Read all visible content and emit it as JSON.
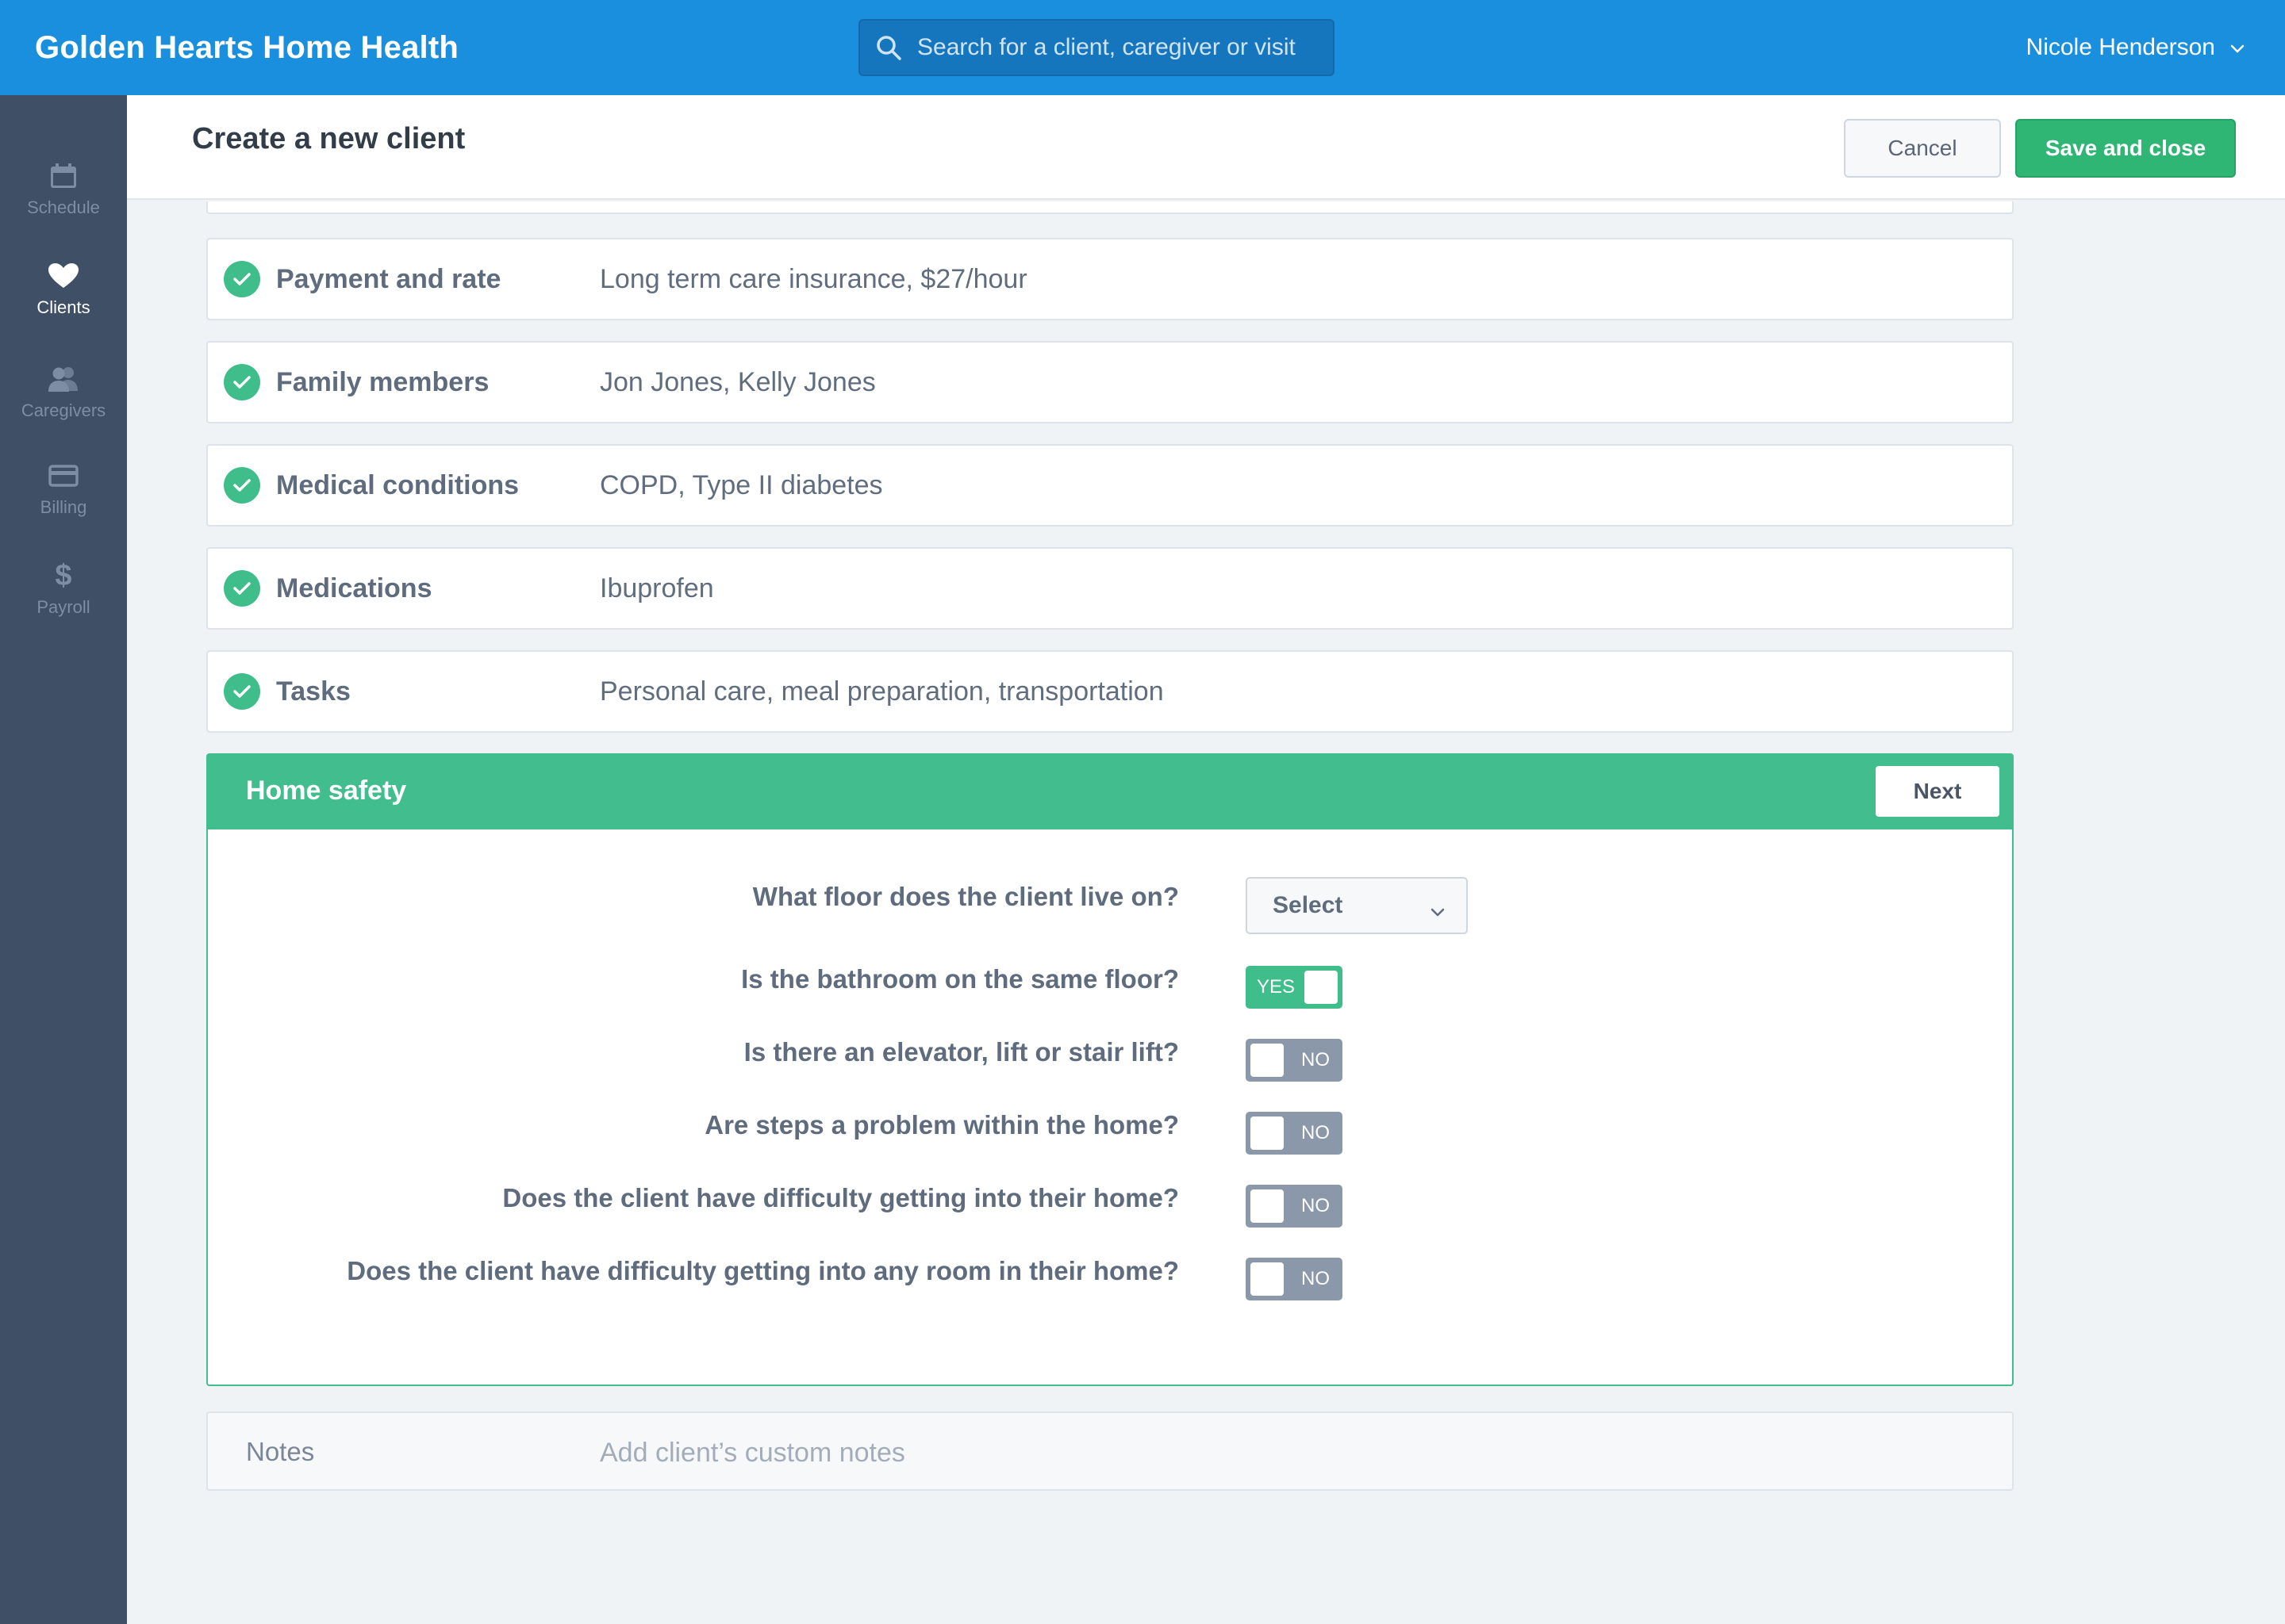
{
  "app": {
    "title": "Golden Hearts Home Health"
  },
  "search": {
    "placeholder": "Search for a client, caregiver or visit"
  },
  "user": {
    "name": "Nicole Henderson"
  },
  "sidebar": {
    "items": [
      {
        "label": "Schedule",
        "icon": "calendar-icon",
        "active": false
      },
      {
        "label": "Clients",
        "icon": "heart-icon",
        "active": true
      },
      {
        "label": "Caregivers",
        "icon": "people-icon",
        "active": false
      },
      {
        "label": "Billing",
        "icon": "credit-card-icon",
        "active": false
      },
      {
        "label": "Payroll",
        "icon": "dollar-icon",
        "active": false
      }
    ]
  },
  "page": {
    "title": "Create a new client",
    "cancel_label": "Cancel",
    "save_label": "Save and close"
  },
  "sections": [
    {
      "label": "Payment and rate",
      "value": "Long term care insurance, $27/hour",
      "complete": true
    },
    {
      "label": "Family members",
      "value": "Jon Jones, Kelly Jones",
      "complete": true
    },
    {
      "label": "Medical conditions",
      "value": "COPD, Type II diabetes",
      "complete": true
    },
    {
      "label": "Medications",
      "value": "Ibuprofen",
      "complete": true
    },
    {
      "label": "Tasks",
      "value": "Personal care, meal preparation, transportation",
      "complete": true
    }
  ],
  "home_safety": {
    "title": "Home safety",
    "next_label": "Next",
    "floor_question": "What floor does the client live on?",
    "floor_select": "Select",
    "questions": [
      {
        "text": "Is the bathroom on the same floor?",
        "value": "YES",
        "on": true
      },
      {
        "text": "Is there an elevator, lift or stair lift?",
        "value": "NO",
        "on": false
      },
      {
        "text": "Are steps a problem within the home?",
        "value": "NO",
        "on": false
      },
      {
        "text": "Does the client have difficulty getting into their home?",
        "value": "NO",
        "on": false
      },
      {
        "text": "Does the client have difficulty getting into any room in their home?",
        "value": "NO",
        "on": false
      }
    ]
  },
  "notes": {
    "label": "Notes",
    "placeholder": "Add client’s custom notes"
  },
  "colors": {
    "topbar": "#1a8fdd",
    "sidebar": "#3e4f66",
    "accent_green": "#42bd8d",
    "save_green": "#2fb574",
    "toggle_off": "#8a98a9"
  }
}
